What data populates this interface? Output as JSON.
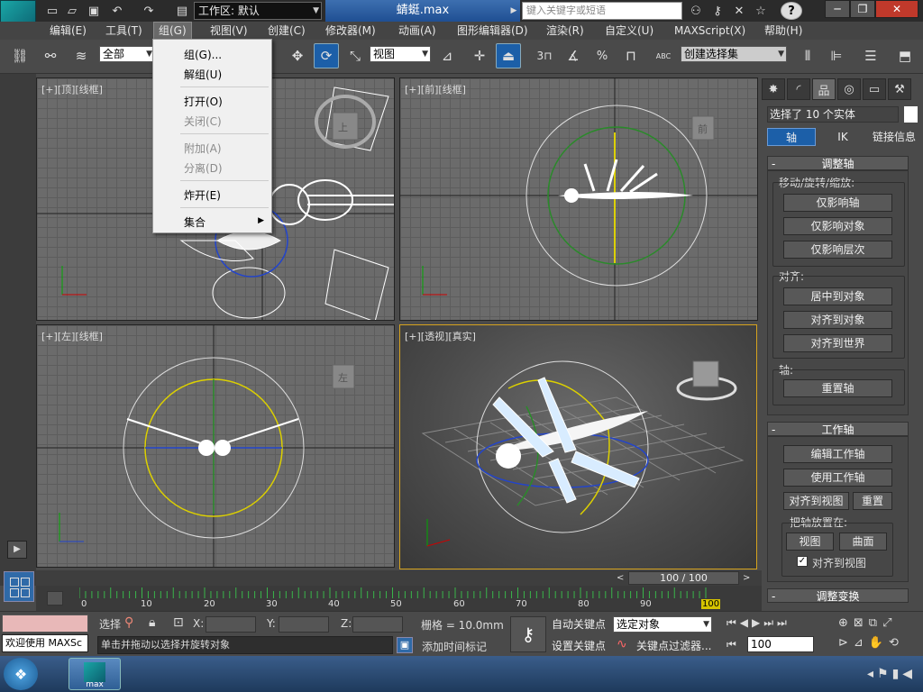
{
  "titlebar": {
    "title": "蜻蜓.max",
    "workspace": "工作区: 默认",
    "search_placeholder": "键入关键字或短语",
    "help": "?"
  },
  "menubar": {
    "items": [
      "编辑(E)",
      "工具(T)",
      "组(G)",
      "视图(V)",
      "创建(C)",
      "修改器(M)",
      "动画(A)",
      "图形编辑器(D)",
      "渲染(R)",
      "自定义(U)",
      "MAXScript(X)",
      "帮助(H)"
    ]
  },
  "toolbar": {
    "filter_combo": "全部",
    "ref_coord_combo": "视图",
    "named_sel_combo": "创建选择集",
    "snap_label": "3",
    "percent_label": "%",
    "abc_label": "ABC"
  },
  "group_menu": {
    "items": [
      {
        "label": "组(G)...",
        "enabled": true
      },
      {
        "label": "解组(U)",
        "enabled": true
      },
      {
        "label": "打开(O)",
        "enabled": true
      },
      {
        "label": "关闭(C)",
        "enabled": false
      },
      {
        "label": "附加(A)",
        "enabled": false
      },
      {
        "label": "分离(D)",
        "enabled": false
      },
      {
        "label": "炸开(E)",
        "enabled": true
      },
      {
        "label": "集合",
        "enabled": true,
        "submenu": true
      }
    ]
  },
  "viewports": {
    "top": {
      "label": "[+][顶][线框]",
      "cube_text": "上"
    },
    "front": {
      "label": "[+][前][线框]",
      "cube_text": "前"
    },
    "left": {
      "label": "[+][左][线框]",
      "cube_text": "左"
    },
    "perspective": {
      "label": "[+][透视][真实]"
    }
  },
  "command_panel": {
    "selection": "选择了 10 个实体",
    "tabs": [
      "轴",
      "IK",
      "链接信息"
    ],
    "adjust_pivot": {
      "title": "调整轴",
      "move_group": "移动/旋转/缩放:",
      "buttons_move": [
        "仅影响轴",
        "仅影响对象",
        "仅影响层次"
      ],
      "align_group": "对齐:",
      "buttons_align": [
        "居中到对象",
        "对齐到对象",
        "对齐到世界"
      ],
      "axis_group": "轴:",
      "reset_pivot": "重置轴"
    },
    "working_pivot": {
      "title": "工作轴",
      "edit": "编辑工作轴",
      "use": "使用工作轴",
      "align_view": "对齐到视图",
      "reset": "重置",
      "place_group": "把轴放置在:",
      "view": "视图",
      "surface": "曲面",
      "align_to_view_chk": "对齐到视图"
    },
    "adjust_transform": {
      "title": "调整变换"
    }
  },
  "timeline": {
    "frame": "100 / 100",
    "ticks": [
      "0",
      "10",
      "20",
      "30",
      "40",
      "50",
      "60",
      "70",
      "80",
      "90",
      "100"
    ]
  },
  "status": {
    "script_text": "欢迎使用 MAXSc",
    "select_label": "选择",
    "x_label": "X:",
    "y_label": "Y:",
    "z_label": "Z:",
    "grid": "栅格 = 10.0mm",
    "auto_key": "自动关键点",
    "set_key": "设置关键点",
    "selected_combo": "选定对象",
    "key_filters": "关键点过滤器...",
    "prompt": "单击并拖动以选择并旋转对象",
    "add_time_tag": "添加时间标记",
    "frame_input": "100"
  },
  "taskbar": {
    "app_label": "max"
  }
}
